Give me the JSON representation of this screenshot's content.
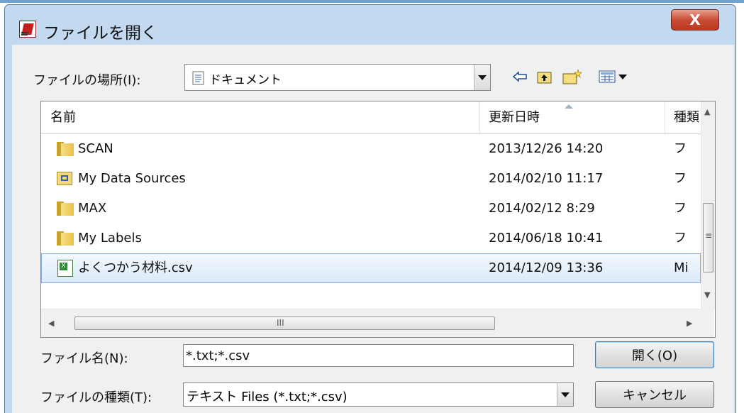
{
  "window": {
    "title": "ファイルを開く",
    "close_glyph": "X"
  },
  "location": {
    "label": "ファイルの場所(I):",
    "value": "ドキュメント"
  },
  "toolbar": {
    "back_icon": "back-arrow-icon",
    "up_icon": "up-folder-icon",
    "newfolder_icon": "new-folder-icon",
    "view_icon": "view-menu-icon"
  },
  "list": {
    "columns": [
      "名前",
      "更新日時",
      "種類"
    ],
    "rows": [
      {
        "name": "SCAN",
        "date": "2013/12/26 14:20",
        "type": "フ",
        "icon": "folder"
      },
      {
        "name": "My Data Sources",
        "date": "2014/02/10 11:17",
        "type": "フ",
        "icon": "data-sources"
      },
      {
        "name": "MAX",
        "date": "2014/02/12 8:29",
        "type": "フ",
        "icon": "folder"
      },
      {
        "name": "My Labels",
        "date": "2014/06/18 10:41",
        "type": "フ",
        "icon": "folder"
      },
      {
        "name": "よくつかう材料.csv",
        "date": "2014/12/09 13:36",
        "type": "Mi",
        "icon": "csv"
      }
    ],
    "hscroll_grip": "III",
    "vscroll_grip": "≡"
  },
  "filename": {
    "label": "ファイル名(N):",
    "value": "*.txt;*.csv"
  },
  "filetype": {
    "label": "ファイルの種類(T):",
    "value": "テキスト Files (*.txt;*.csv)"
  },
  "buttons": {
    "open": "開く(O)",
    "cancel": "キャンセル"
  },
  "colors": {
    "frame": "#c2d9ef",
    "close": "#c84d34",
    "selection": "#dbeaf9"
  }
}
